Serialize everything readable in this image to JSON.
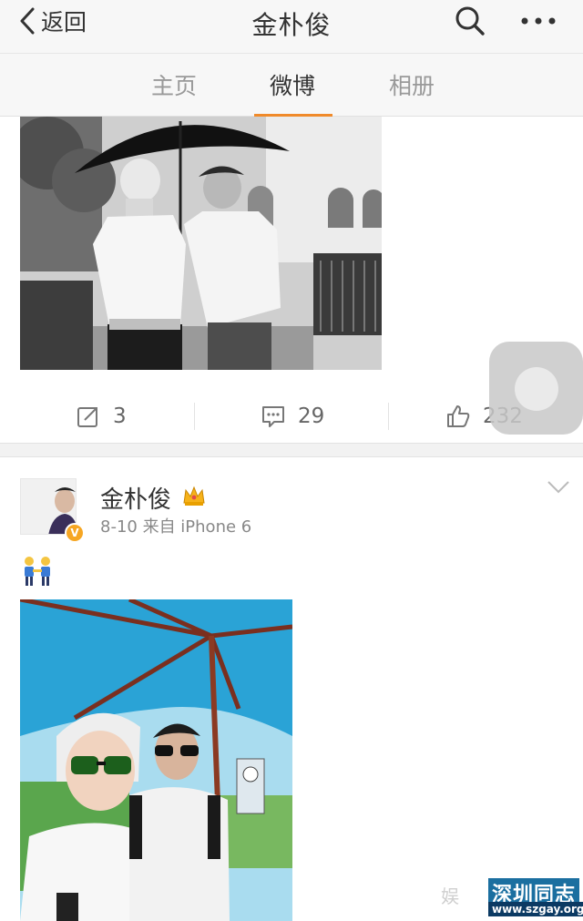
{
  "header": {
    "back_label": "返回",
    "title": "金朴俊",
    "icons": {
      "back": "chevron-left-icon",
      "search": "search-icon",
      "more": "more-dots-icon"
    }
  },
  "tabs": [
    {
      "label": "主页",
      "active": false
    },
    {
      "label": "微博",
      "active": true
    },
    {
      "label": "相册",
      "active": false
    }
  ],
  "colors": {
    "accent": "#f08a2a",
    "verified": "#f6a623",
    "umbrella": "#2aa3d6"
  },
  "post1": {
    "photo": "black-and-white photo of two men under an umbrella",
    "actions": {
      "repost_count": "3",
      "comment_count": "29",
      "like_count": "232"
    }
  },
  "post2": {
    "username": "金朴俊",
    "meta": "8-10  来自 iPhone 6",
    "badge": "V",
    "emoji": "two-men-holding-hands",
    "photo": "selfie of two men under a blue umbrella"
  },
  "watermark": {
    "text1": "娱",
    "text2": "深圳同志",
    "url": "www.szgay.org"
  }
}
